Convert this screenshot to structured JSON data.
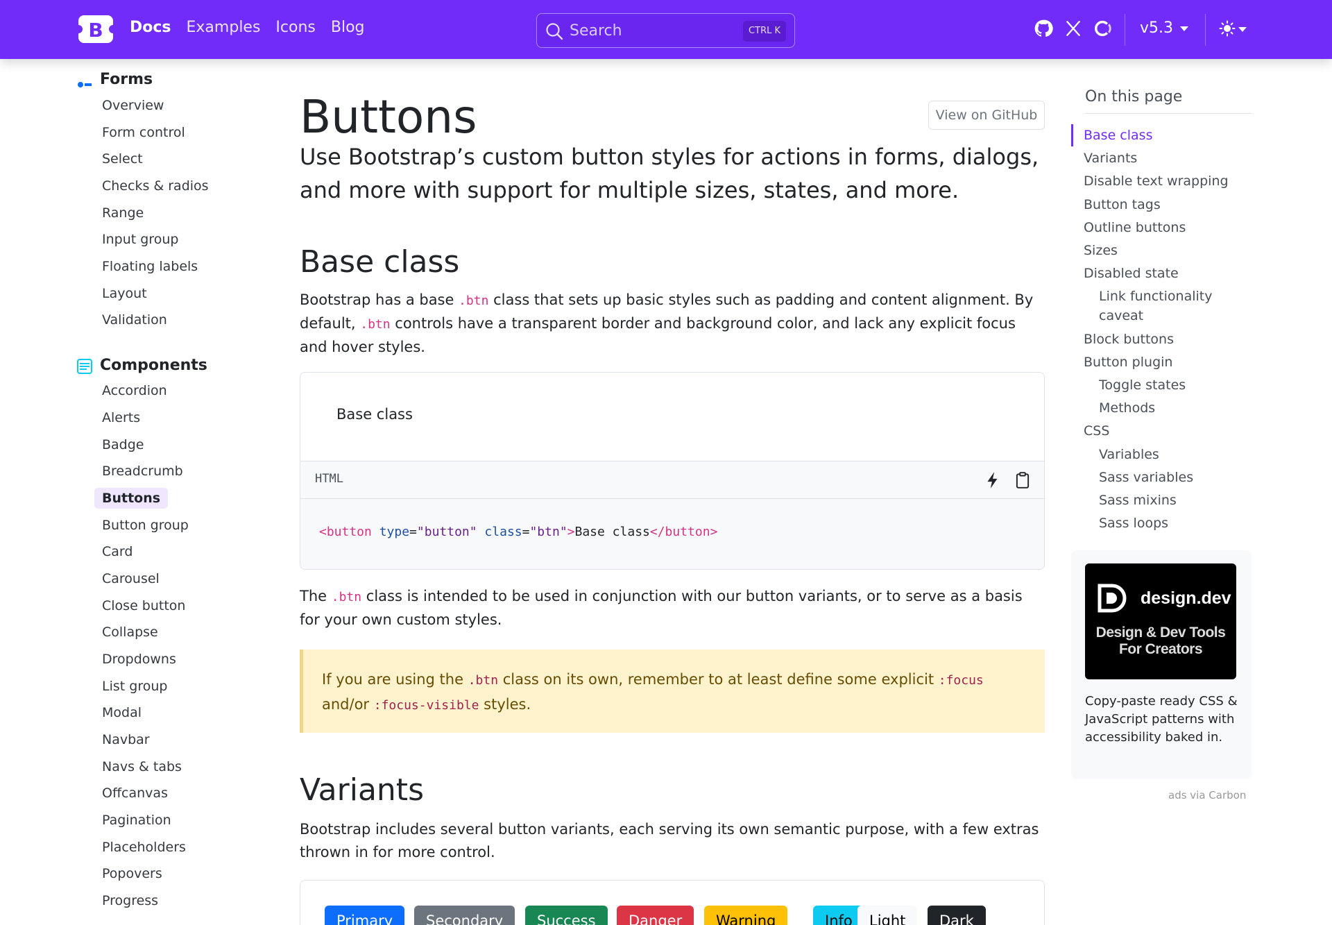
{
  "navbar": {
    "brand_letter": "B",
    "links": [
      "Docs",
      "Examples",
      "Icons",
      "Blog"
    ],
    "search_placeholder": "Search",
    "search_shortcut": "CTRL K",
    "version": "v5.3",
    "colors": {
      "bg": "#712cf9"
    }
  },
  "sidebar": {
    "forms_title": "Forms",
    "forms_items": [
      "Overview",
      "Form control",
      "Select",
      "Checks & radios",
      "Range",
      "Input group",
      "Floating labels",
      "Layout",
      "Validation"
    ],
    "components_title": "Components",
    "components_items": [
      "Accordion",
      "Alerts",
      "Badge",
      "Breadcrumb",
      "Buttons",
      "Button group",
      "Card",
      "Carousel",
      "Close button",
      "Collapse",
      "Dropdowns",
      "List group",
      "Modal",
      "Navbar",
      "Navs & tabs",
      "Offcanvas",
      "Pagination",
      "Placeholders",
      "Popovers",
      "Progress"
    ],
    "active": "Buttons"
  },
  "main": {
    "title": "Buttons",
    "github_label": "View on GitHub",
    "lead": "Use Bootstrap’s custom button styles for actions in forms, dialogs, and more with support for multiple sizes, states, and more.",
    "base_heading": "Base class",
    "base_p1": {
      "a": "Bootstrap has a base ",
      "code": ".btn",
      "b": " class that sets up basic styles such as padding and content alignment. By default, ",
      "code2": ".btn",
      "c": " controls have a transparent border and background color, and lack any explicit focus and hover styles."
    },
    "example": {
      "preview_text": "Base class",
      "lang": "HTML",
      "code": {
        "open": "<button",
        "attr1": " type",
        "eq1": "=",
        "val1": "\"button\"",
        "attr2": " class",
        "eq2": "=",
        "val2": "\"btn\"",
        "close": ">",
        "text": "Base class",
        "end": "</button>"
      }
    },
    "base_p2": {
      "a": "The ",
      "code": ".btn",
      "b": " class is intended to be used in conjunction with our button variants, or to serve as a basis for your own custom styles."
    },
    "callout": {
      "a": "If you are using the ",
      "code": ".btn",
      "b": " class on its own, remember to at least define some explicit ",
      "code2": ":focus",
      "c": " and/or ",
      "code3": ":focus-visible",
      "d": " styles."
    },
    "variants_heading": "Variants",
    "variants_p": "Bootstrap includes several button variants, each serving its own semantic purpose, with a few extras thrown in for more control.",
    "variant_buttons": [
      {
        "label": "Primary",
        "color": "#0d6efd",
        "text": "#ffffff"
      },
      {
        "label": "Secondary",
        "color": "#6c757d",
        "text": "#ffffff"
      },
      {
        "label": "Success",
        "color": "#198754",
        "text": "#ffffff"
      },
      {
        "label": "Danger",
        "color": "#dc3545",
        "text": "#ffffff"
      },
      {
        "label": "Warning",
        "color": "#ffc107",
        "text": "#000000"
      },
      {
        "label": "Info",
        "color": "#0dcaf0",
        "text": "#000000"
      },
      {
        "label": "Light",
        "color": "#f8f9fa",
        "text": "#000000"
      },
      {
        "label": "Dark",
        "color": "#212529",
        "text": "#ffffff"
      }
    ]
  },
  "toc": {
    "title": "On this page",
    "items": [
      {
        "label": "Base class",
        "sub": false,
        "active": true
      },
      {
        "label": "Variants",
        "sub": false
      },
      {
        "label": "Disable text wrapping",
        "sub": false
      },
      {
        "label": "Button tags",
        "sub": false
      },
      {
        "label": "Outline buttons",
        "sub": false
      },
      {
        "label": "Sizes",
        "sub": false
      },
      {
        "label": "Disabled state",
        "sub": false
      },
      {
        "label": "Link functionality",
        "sub": true
      },
      {
        "label": "caveat",
        "sub": true,
        "cont": true
      },
      {
        "label": "Block buttons",
        "sub": false
      },
      {
        "label": "Button plugin",
        "sub": false
      },
      {
        "label": "Toggle states",
        "sub": true
      },
      {
        "label": "Methods",
        "sub": true
      },
      {
        "label": "CSS",
        "sub": false
      },
      {
        "label": "Variables",
        "sub": true
      },
      {
        "label": "Sass variables",
        "sub": true
      },
      {
        "label": "Sass mixins",
        "sub": true
      },
      {
        "label": "Sass loops",
        "sub": true
      }
    ]
  },
  "ad": {
    "name": "design.dev",
    "tagline_1": "Design & Dev Tools",
    "tagline_2": "For Creators",
    "text": "Copy-paste ready CSS & JavaScript patterns with accessibility baked in.",
    "via": "ads via Carbon"
  },
  "icons": [
    "bootstrap-logo-icon",
    "search-icon",
    "github-icon",
    "x-twitter-icon",
    "opencollective-icon",
    "theme-sun-icon",
    "lightning-icon",
    "clipboard-icon",
    "forms-icon",
    "components-icon"
  ]
}
